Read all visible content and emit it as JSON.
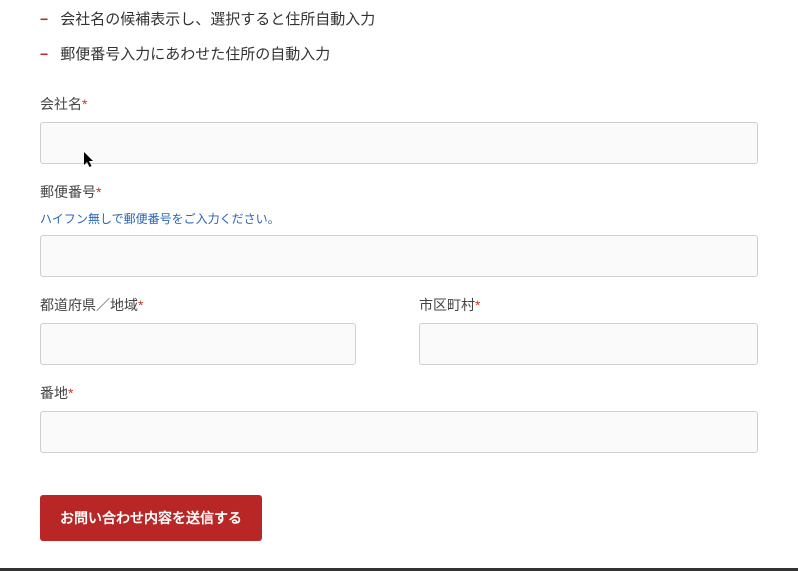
{
  "bullets": [
    "会社名の候補表示し、選択すると住所自動入力",
    "郵便番号入力にあわせた住所の自動入力"
  ],
  "fields": {
    "company": {
      "label": "会社名",
      "req": "*"
    },
    "postal": {
      "label": "郵便番号",
      "req": "*",
      "help": "ハイフン無しで郵便番号をご入力ください。"
    },
    "prefecture": {
      "label": "都道府県／地域",
      "req": "*"
    },
    "city": {
      "label": "市区町村",
      "req": "*"
    },
    "street": {
      "label": "番地",
      "req": "*"
    }
  },
  "submit": {
    "label": "お問い合わせ内容を送信する"
  }
}
